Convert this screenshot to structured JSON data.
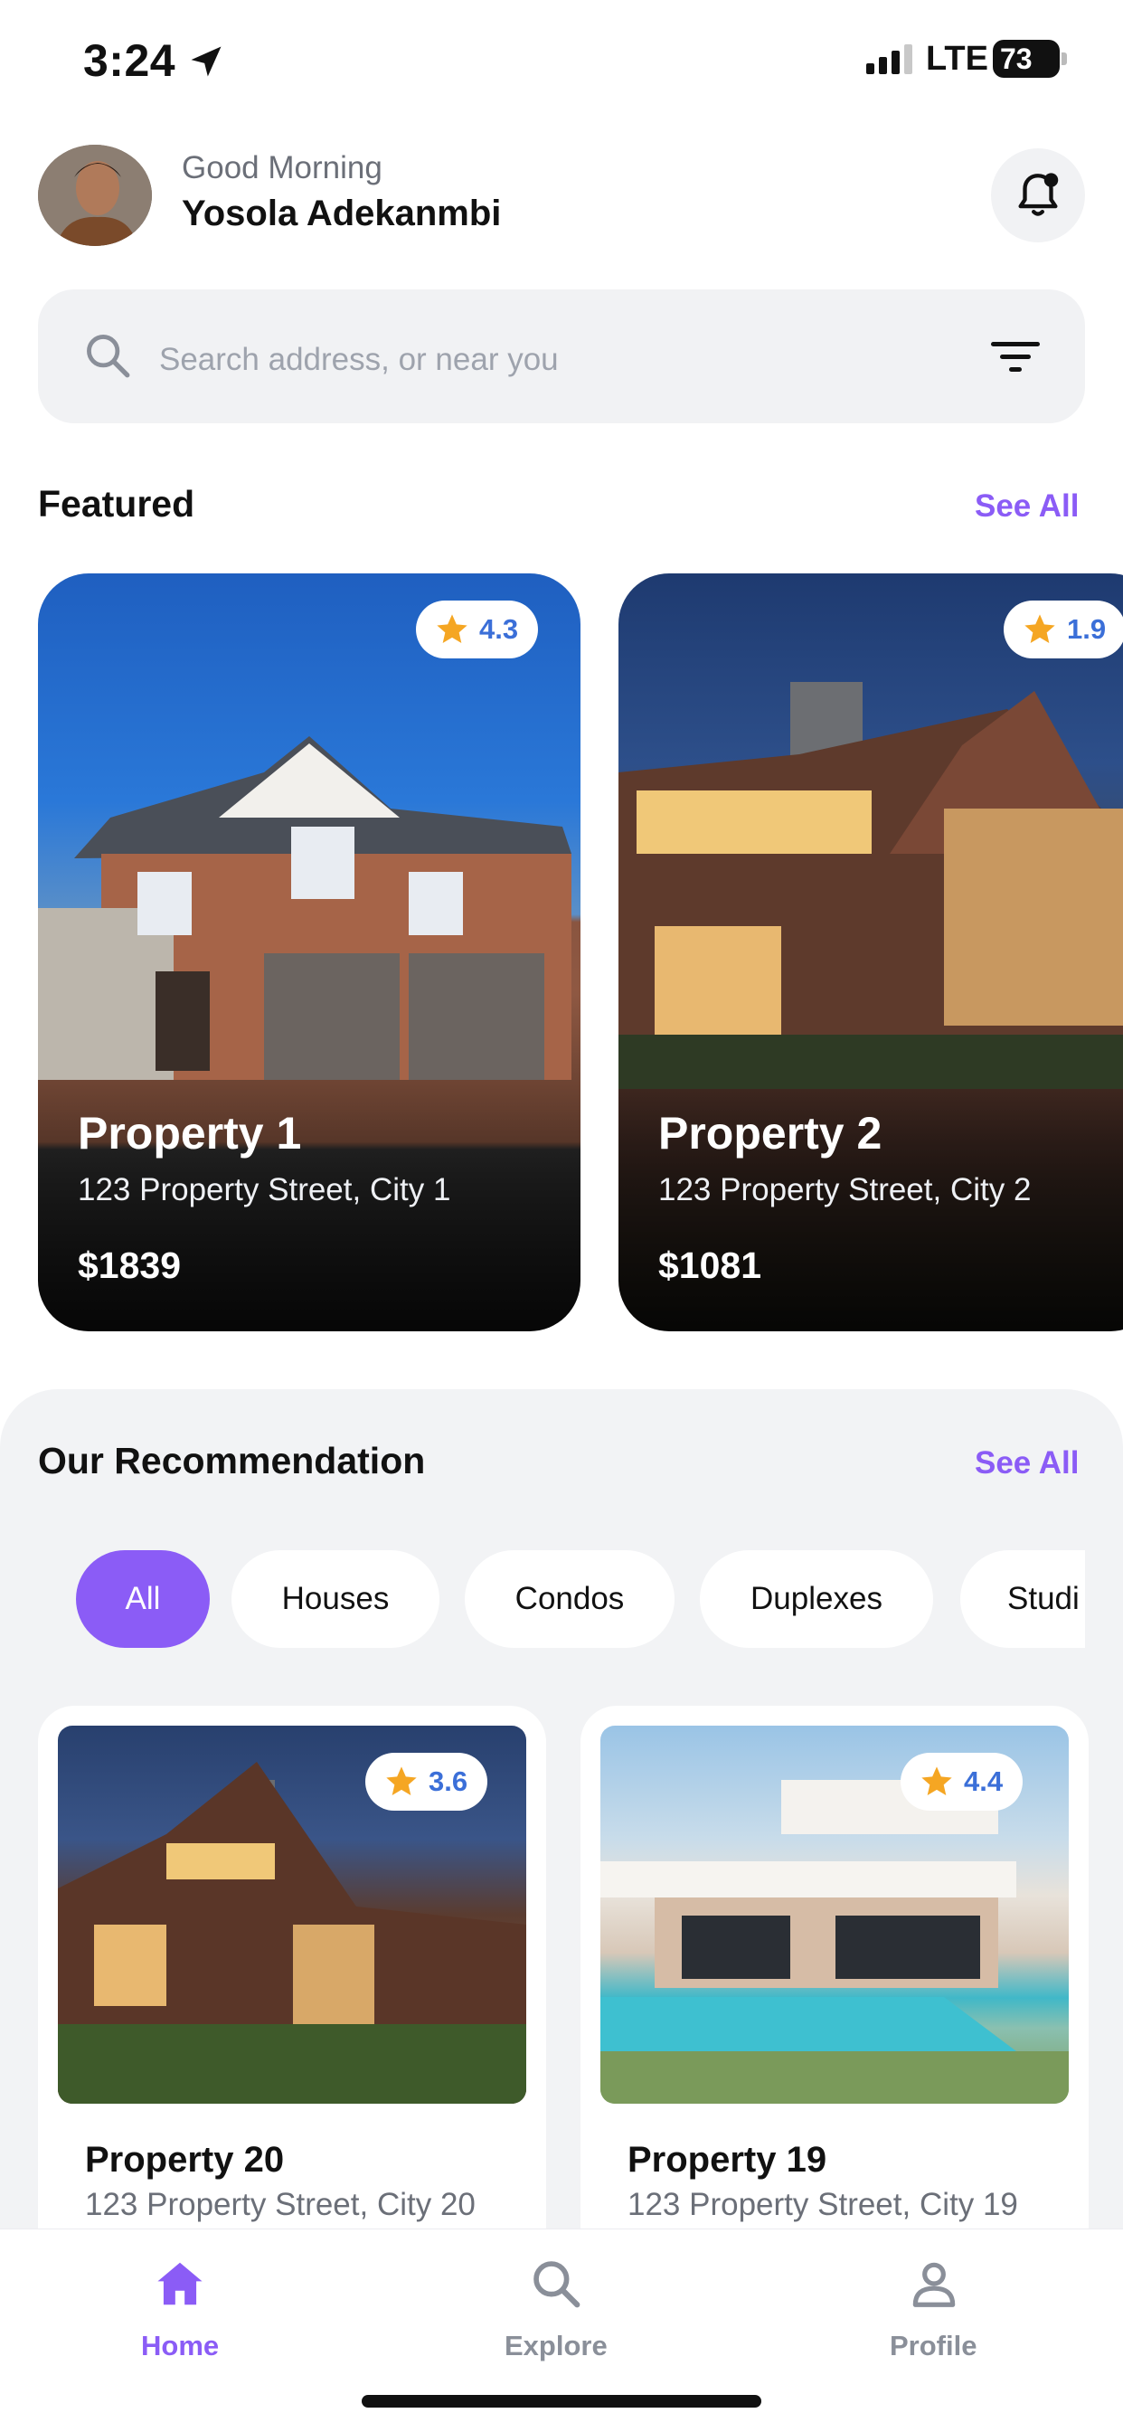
{
  "status_bar": {
    "time": "3:24",
    "network": "LTE",
    "battery": "73"
  },
  "header": {
    "greeting": "Good Morning",
    "user_name": "Yosola Adekanmbi"
  },
  "search": {
    "placeholder": "Search address, or near you"
  },
  "featured": {
    "title": "Featured",
    "see_all": "See All",
    "cards": [
      {
        "name": "Property 1",
        "address": "123 Property Street, City 1",
        "price": "$1839",
        "rating": "4.3"
      },
      {
        "name": "Property 2",
        "address": "123 Property Street, City 2",
        "price": "$1081",
        "rating": "1.9"
      }
    ]
  },
  "recommendation": {
    "title": "Our Recommendation",
    "see_all": "See All",
    "filters": [
      "All",
      "Houses",
      "Condos",
      "Duplexes",
      "Studi"
    ],
    "active_filter": "All",
    "cards": [
      {
        "name": "Property 20",
        "address": "123 Property Street, City 20",
        "rating": "3.6"
      },
      {
        "name": "Property 19",
        "address": "123 Property Street, City 19",
        "rating": "4.4"
      }
    ]
  },
  "tabs": [
    {
      "label": "Home",
      "icon": "home-icon",
      "active": true
    },
    {
      "label": "Explore",
      "icon": "search-icon",
      "active": false
    },
    {
      "label": "Profile",
      "icon": "person-icon",
      "active": false
    }
  ],
  "colors": {
    "accent": "#8b5cf6",
    "rating_text": "#3b6fd8",
    "star": "#f5a623"
  }
}
